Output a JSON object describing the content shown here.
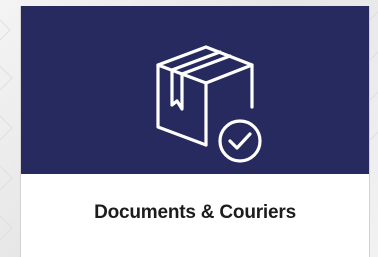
{
  "card": {
    "title": "Documents & Couriers",
    "icon": "package-check-icon",
    "header_color": "#262a5e",
    "icon_color": "#ffffff",
    "background_color": "#ffffff"
  }
}
